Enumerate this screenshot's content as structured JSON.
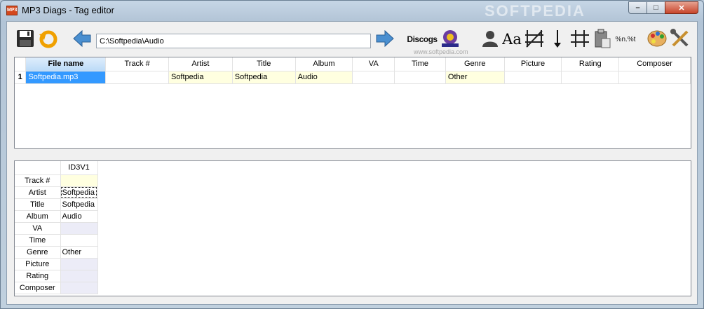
{
  "window": {
    "title": "MP3 Diags - Tag editor",
    "app_icon_text": "MP3",
    "watermark": "SOFTPEDIA",
    "controls": {
      "minimize": "–",
      "maximize": "□",
      "close": "✕"
    }
  },
  "toolbar": {
    "path": "C:\\Softpedia\\Audio",
    "discogs_label": "Discogs",
    "format_label": "%n.%t",
    "case_label": "Aa",
    "watermark_url": "www.softpedia.com"
  },
  "files_table": {
    "columns": [
      "File name",
      "Track #",
      "Artist",
      "Title",
      "Album",
      "VA",
      "Time",
      "Genre",
      "Picture",
      "Rating",
      "Composer"
    ],
    "rows": [
      {
        "num": "1",
        "cells": [
          "Softpedia.mp3",
          "",
          "Softpedia",
          "Softpedia",
          "Audio",
          "",
          "",
          "Other",
          "",
          "",
          ""
        ]
      }
    ]
  },
  "tag_table": {
    "column": "ID3V1",
    "rows": [
      {
        "field": "Track #",
        "value": ""
      },
      {
        "field": "Artist",
        "value": "Softpedia"
      },
      {
        "field": "Title",
        "value": "Softpedia"
      },
      {
        "field": "Album",
        "value": "Audio"
      },
      {
        "field": "VA",
        "value": ""
      },
      {
        "field": "Time",
        "value": ""
      },
      {
        "field": "Genre",
        "value": "Other"
      },
      {
        "field": "Picture",
        "value": ""
      },
      {
        "field": "Rating",
        "value": ""
      },
      {
        "field": "Composer",
        "value": ""
      }
    ]
  },
  "colors": {
    "selection": "#3399ff",
    "tag_highlight": "#ffffe0",
    "empty_field": "#ececf7"
  }
}
